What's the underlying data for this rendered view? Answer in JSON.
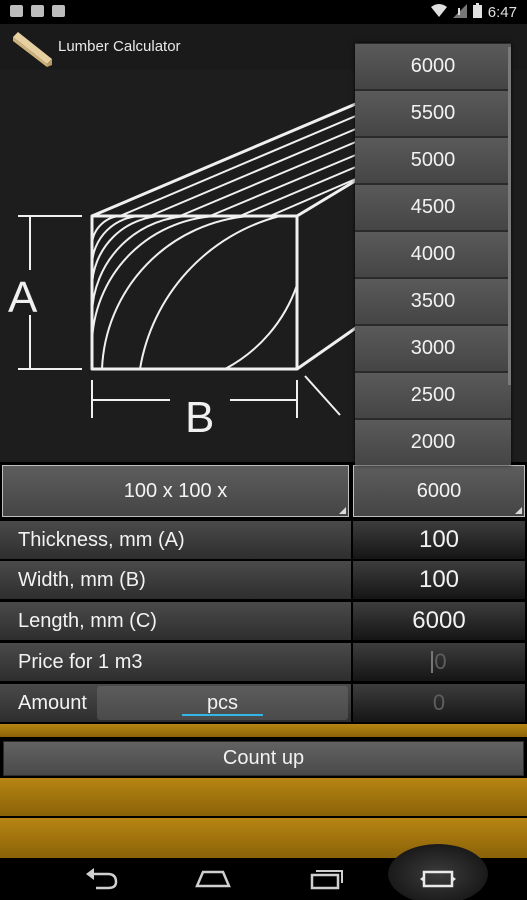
{
  "status_bar": {
    "time": "6:47",
    "icons": [
      "notification-icon",
      "clipboard-icon",
      "camera-icon",
      "wifi-icon",
      "no-signal-icon",
      "battery-icon"
    ]
  },
  "action_bar": {
    "title": "Lumber Calculator",
    "logo": "lumber-board-icon"
  },
  "illustration": {
    "label_a": "A",
    "label_b": "B"
  },
  "dropdown": {
    "options": [
      "6000",
      "5500",
      "5000",
      "4500",
      "4000",
      "3500",
      "3000",
      "2500",
      "2000"
    ]
  },
  "selectors": {
    "size_label": "100 x 100 x",
    "length_selected": "6000"
  },
  "rows": {
    "thickness": {
      "label": "Thickness, mm (A)",
      "value": "100"
    },
    "width": {
      "label": "Width, mm (B)",
      "value": "100"
    },
    "length": {
      "label": "Length, mm (C)",
      "value": "6000"
    },
    "price": {
      "label": "Price for 1 m3",
      "placeholder": "0"
    },
    "amount": {
      "label": "Amount",
      "unit": "pcs",
      "placeholder": "0"
    }
  },
  "count_button": "Count up",
  "colors": {
    "accent": "#33b5e5",
    "wood": "#a87a0f"
  },
  "nav": [
    "back-icon",
    "home-icon",
    "recent-apps-icon",
    "fullscreen-icon"
  ]
}
